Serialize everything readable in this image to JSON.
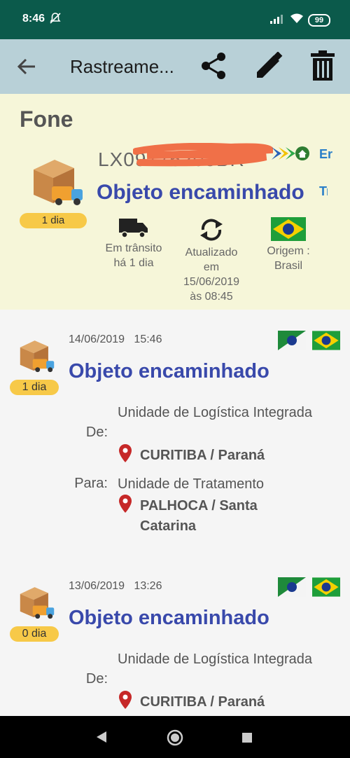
{
  "status_bar": {
    "time": "8:46",
    "battery": "99"
  },
  "app_bar": {
    "title": "Rastreame..."
  },
  "summary": {
    "name": "Fone",
    "tracking_code": "LX09776203BR",
    "status": "Objeto encaminhado",
    "days_badge": "1 dia",
    "cut_text_top": "Er",
    "cut_text_mid": "Tr",
    "transit_label": "Em trânsito há 1 dia",
    "updated_label": "Atualizado em 15/06/2019 às 08:45",
    "origin_label": "Origem : Brasil",
    "colors": {
      "accent": "#3949ab",
      "badge": "#f7c948"
    }
  },
  "events": [
    {
      "date": "14/06/2019",
      "time": "15:46",
      "days_badge": "1 dia",
      "status": "Objeto encaminhado",
      "from_label": "De:",
      "from_unit": "Unidade de Logística Integrada",
      "from_city": "CURITIBA / Paraná",
      "to_label": "Para:",
      "to_unit": "Unidade de Tratamento",
      "to_city": "PALHOCA / Santa Catarina"
    },
    {
      "date": "13/06/2019",
      "time": "13:26",
      "days_badge": "0 dia",
      "status": "Objeto encaminhado",
      "from_label": "De:",
      "from_unit": "Unidade de Logística Integrada",
      "from_city": "CURITIBA / Paraná"
    }
  ]
}
